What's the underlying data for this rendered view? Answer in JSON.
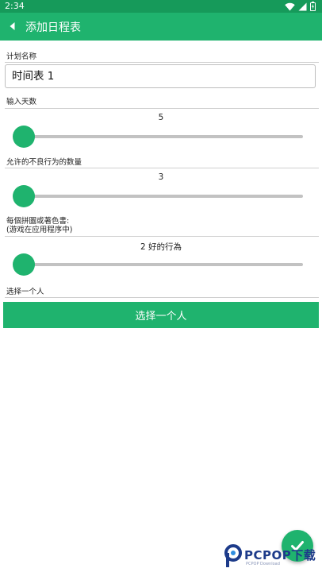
{
  "status_bar": {
    "time": "2:34"
  },
  "app_bar": {
    "title": "添加日程表"
  },
  "plan_name": {
    "label": "计划名称",
    "value": "时间表 1"
  },
  "days": {
    "label": "输入天数",
    "value": 5,
    "fraction": 0.0
  },
  "bad_behaviors": {
    "label": "允许的不良行为的数量",
    "value": 3,
    "fraction": 0.0
  },
  "puzzle": {
    "label_line1": "每個拼圖或著色書:",
    "label_line2": "(游戏在应用程序中)",
    "value": "2 好的行為",
    "fraction": 0.0
  },
  "person": {
    "label": "选择一个人",
    "button_label": "选择一个人"
  },
  "watermark": {
    "text": "PCPOP下载",
    "sub": "PCPOP Download"
  },
  "colors": {
    "accent": "#1fb36e",
    "status_bar": "#169a5a",
    "track": "#c2c2c2"
  },
  "icons": {
    "back": "back-arrow-icon",
    "wifi": "wifi-icon",
    "signal": "signal-icon",
    "battery": "battery-icon",
    "save": "checkmark-icon"
  }
}
